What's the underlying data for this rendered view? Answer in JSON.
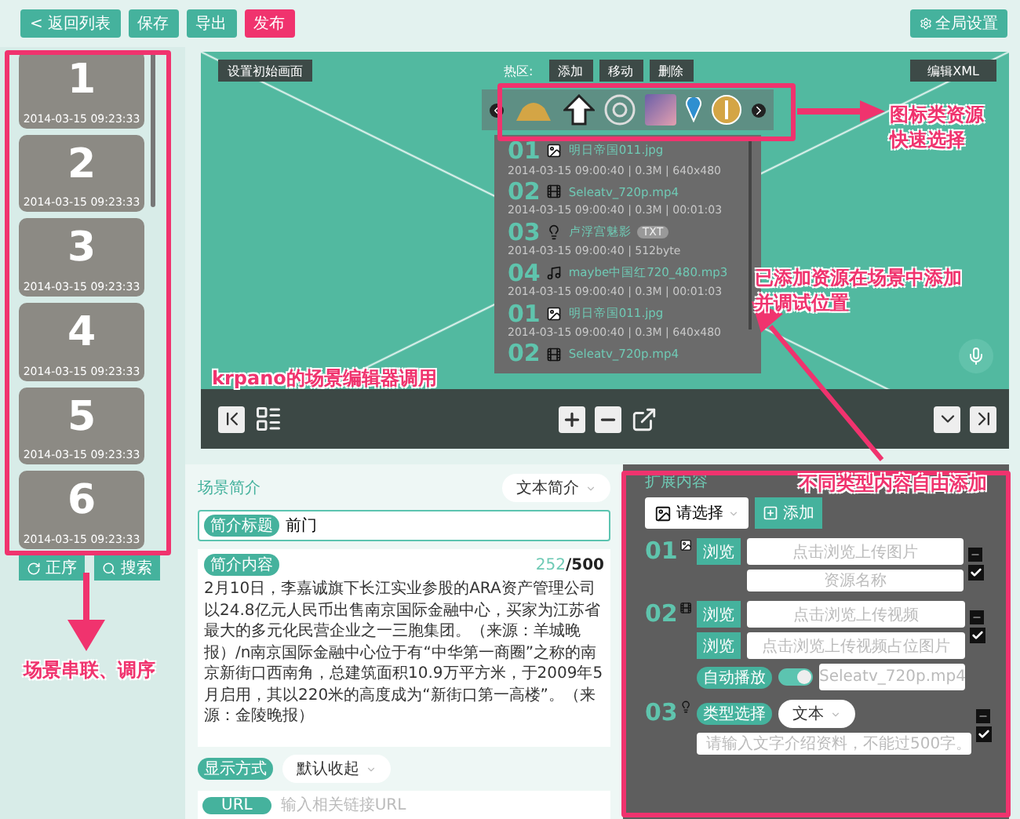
{
  "toolbar": {
    "buttons": [
      {
        "label": "< 返回列表",
        "kind": "normal"
      },
      {
        "label": "保存",
        "kind": "normal"
      },
      {
        "label": "导出",
        "kind": "normal"
      },
      {
        "label": "发布",
        "kind": "primary"
      }
    ],
    "settings": "全局设置"
  },
  "scenes": [
    {
      "number": "1",
      "date": "2014-03-15 09:23:33"
    },
    {
      "number": "2",
      "date": "2014-03-15 09:23:33"
    },
    {
      "number": "3",
      "date": "2014-03-15 09:23:33"
    },
    {
      "number": "4",
      "date": "2014-03-15 09:23:33"
    },
    {
      "number": "5",
      "date": "2014-03-15 09:23:33"
    },
    {
      "number": "6",
      "date": "2014-03-15 09:23:33"
    }
  ],
  "scene_buttons": [
    {
      "label": "正序",
      "kind": "sort"
    },
    {
      "label": "搜索",
      "kind": "search"
    }
  ],
  "viewer": {
    "initial_view": "设置初始画面",
    "hotspot_label": "热区:",
    "hotspot_buttons": [
      "添加",
      "移动",
      "删除"
    ],
    "edit_xml": "编辑XML",
    "resources": [
      {
        "index": "01",
        "kind": "image",
        "name": "明日帝国011.jpg",
        "meta": "2014-03-15 09:00:40 | 0.3M | 640x480"
      },
      {
        "index": "02",
        "kind": "video",
        "name": "Seleatv_720p.mp4",
        "meta": "2014-03-15 09:00:40 | 0.3M | 00:01:03"
      },
      {
        "index": "03",
        "kind": "text",
        "name": "卢浮宫魅影",
        "tag": "TXT",
        "meta": "2014-03-15 09:00:40 | 512byte"
      },
      {
        "index": "04",
        "kind": "audio",
        "name": "maybe中国红720_480.mp3",
        "meta": "2014-03-15 09:00:40 | 0.3M | 00:01:03"
      },
      {
        "index": "01",
        "kind": "image",
        "name": "明日帝国011.jpg",
        "meta": "2014-03-15 09:00:40 | 0.3M | 640x480"
      },
      {
        "index": "02",
        "kind": "video",
        "name": "Seleatv_720p.mp4"
      }
    ]
  },
  "intro": {
    "title": "场景简介",
    "type": "文本简介",
    "title_label": "简介标题",
    "title_value": "前门",
    "content_label": "简介内容",
    "count": "252",
    "limit": "/500",
    "content": "2月10日，李嘉诚旗下长江实业参股的ARA资产管理公司以24.8亿元人民币出售南京国际金融中心，买家为江苏省最大的多元化民营企业之一三胞集团。（来源：羊城晚报）/n南京国际金融中心位于有“中华第一商圈”之称的南京新街口西南角，总建筑面积10.9万平方米，于2009年5月启用，其以220米的高度成为“新街口第一高楼”。（来源：金陵晚报）",
    "display_label": "显示方式",
    "display_value": "默认收起",
    "url_label": "URL",
    "url_placeholder": "输入相关链接URL"
  },
  "extended": {
    "title": "扩展内容",
    "select": "请选择",
    "add": "添加",
    "items": [
      {
        "index": "01",
        "kind": "image",
        "checked": true,
        "browse": "浏览",
        "upload_placeholder": "点击浏览上传图片",
        "name_placeholder": "资源名称"
      },
      {
        "index": "02",
        "kind": "video",
        "checked": true,
        "browse": "浏览",
        "upload_placeholder": "点击浏览上传视频",
        "browse2": "浏览",
        "cover_placeholder": "点击浏览上传视频占位图片",
        "autoplay_label": "自动播放",
        "autoplay_on": true,
        "file": "Seleatv_720p.mp4"
      },
      {
        "index": "03",
        "kind": "text",
        "checked": true,
        "type_label": "类型选择",
        "type_value": "文本",
        "text_placeholder": "请输入文字介绍资料，不能过500字。"
      }
    ]
  },
  "annotations": [
    {
      "lines": [
        "图标类资源",
        "快速选择"
      ]
    },
    {
      "lines": [
        "已添加资源在场景中添加",
        "并调试位置"
      ]
    },
    {
      "lines": [
        "不同类型内容自由添加"
      ]
    },
    {
      "lines": [
        "krpano的场景编辑器调用"
      ]
    },
    {
      "lines": [
        "场景串联、调序"
      ]
    }
  ]
}
